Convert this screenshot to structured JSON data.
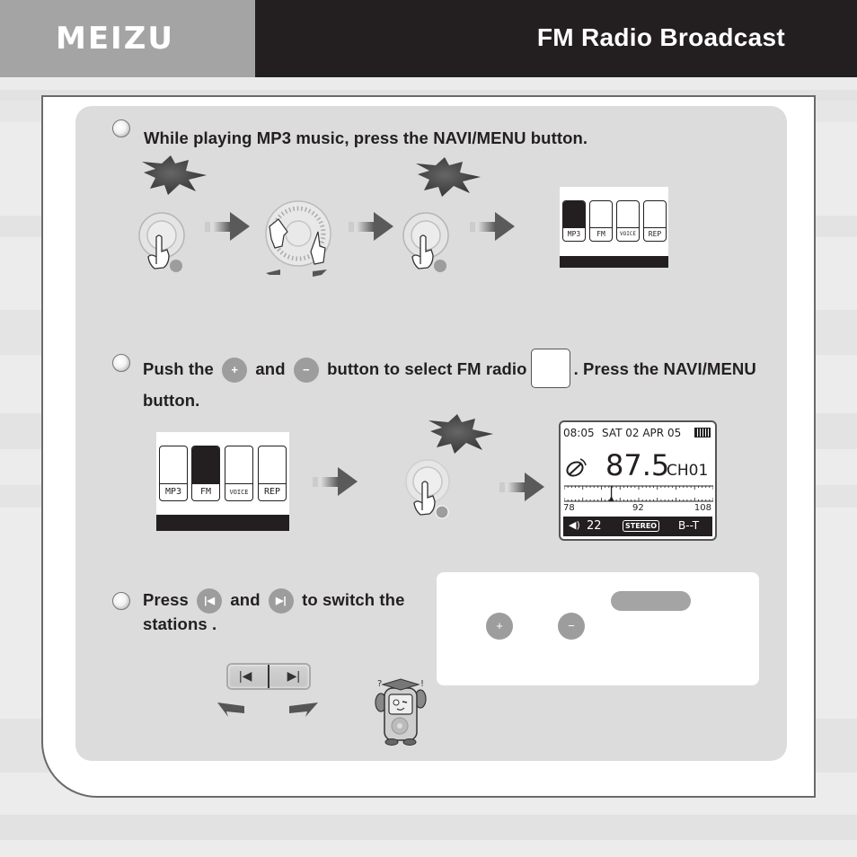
{
  "header": {
    "brand": "MEIZU",
    "title": "FM Radio Broadcast"
  },
  "steps": [
    {
      "text": "While playing MP3 music, press the NAVI/MENU button."
    },
    {
      "text_parts": [
        "Push the",
        "and",
        "button to select FM radio",
        ". Press the NAVI/MENU",
        "button."
      ],
      "icons": [
        "volume-up-icon",
        "volume-down-icon",
        "fm-radio-icon"
      ]
    },
    {
      "text_parts": [
        "Press",
        "and",
        "to switch the",
        "stations ."
      ],
      "icons": [
        "previous-track-icon",
        "next-track-icon"
      ]
    }
  ],
  "menu_screen": {
    "items": [
      {
        "label": "MP3",
        "icon": "music-note-icon"
      },
      {
        "label": "FM",
        "icon": "radio-icon"
      },
      {
        "label": "VOICE",
        "icon": "microphone-icon"
      },
      {
        "label": "REP",
        "icon": "repeat-ab-icon"
      }
    ],
    "first_selected": "MP3",
    "second_selected": "FM"
  },
  "fm_screen": {
    "time": "08:05",
    "date": "SAT 02 APR 05",
    "frequency": "87.5",
    "channel": "CH01",
    "scale_min": "78",
    "scale_mid": "92",
    "scale_max": "108",
    "volume": "22",
    "stereo": "STEREO",
    "mode": "B--T",
    "tuner_position_mhz": 87.5
  },
  "info_box": {
    "icons": [
      "volume-up-icon",
      "volume-down-icon"
    ]
  },
  "colors": {
    "header_dark": "#231f20",
    "header_gray": "#a5a4a5",
    "panel": "#dcdcdc",
    "button_gray": "#9d9d9d"
  }
}
